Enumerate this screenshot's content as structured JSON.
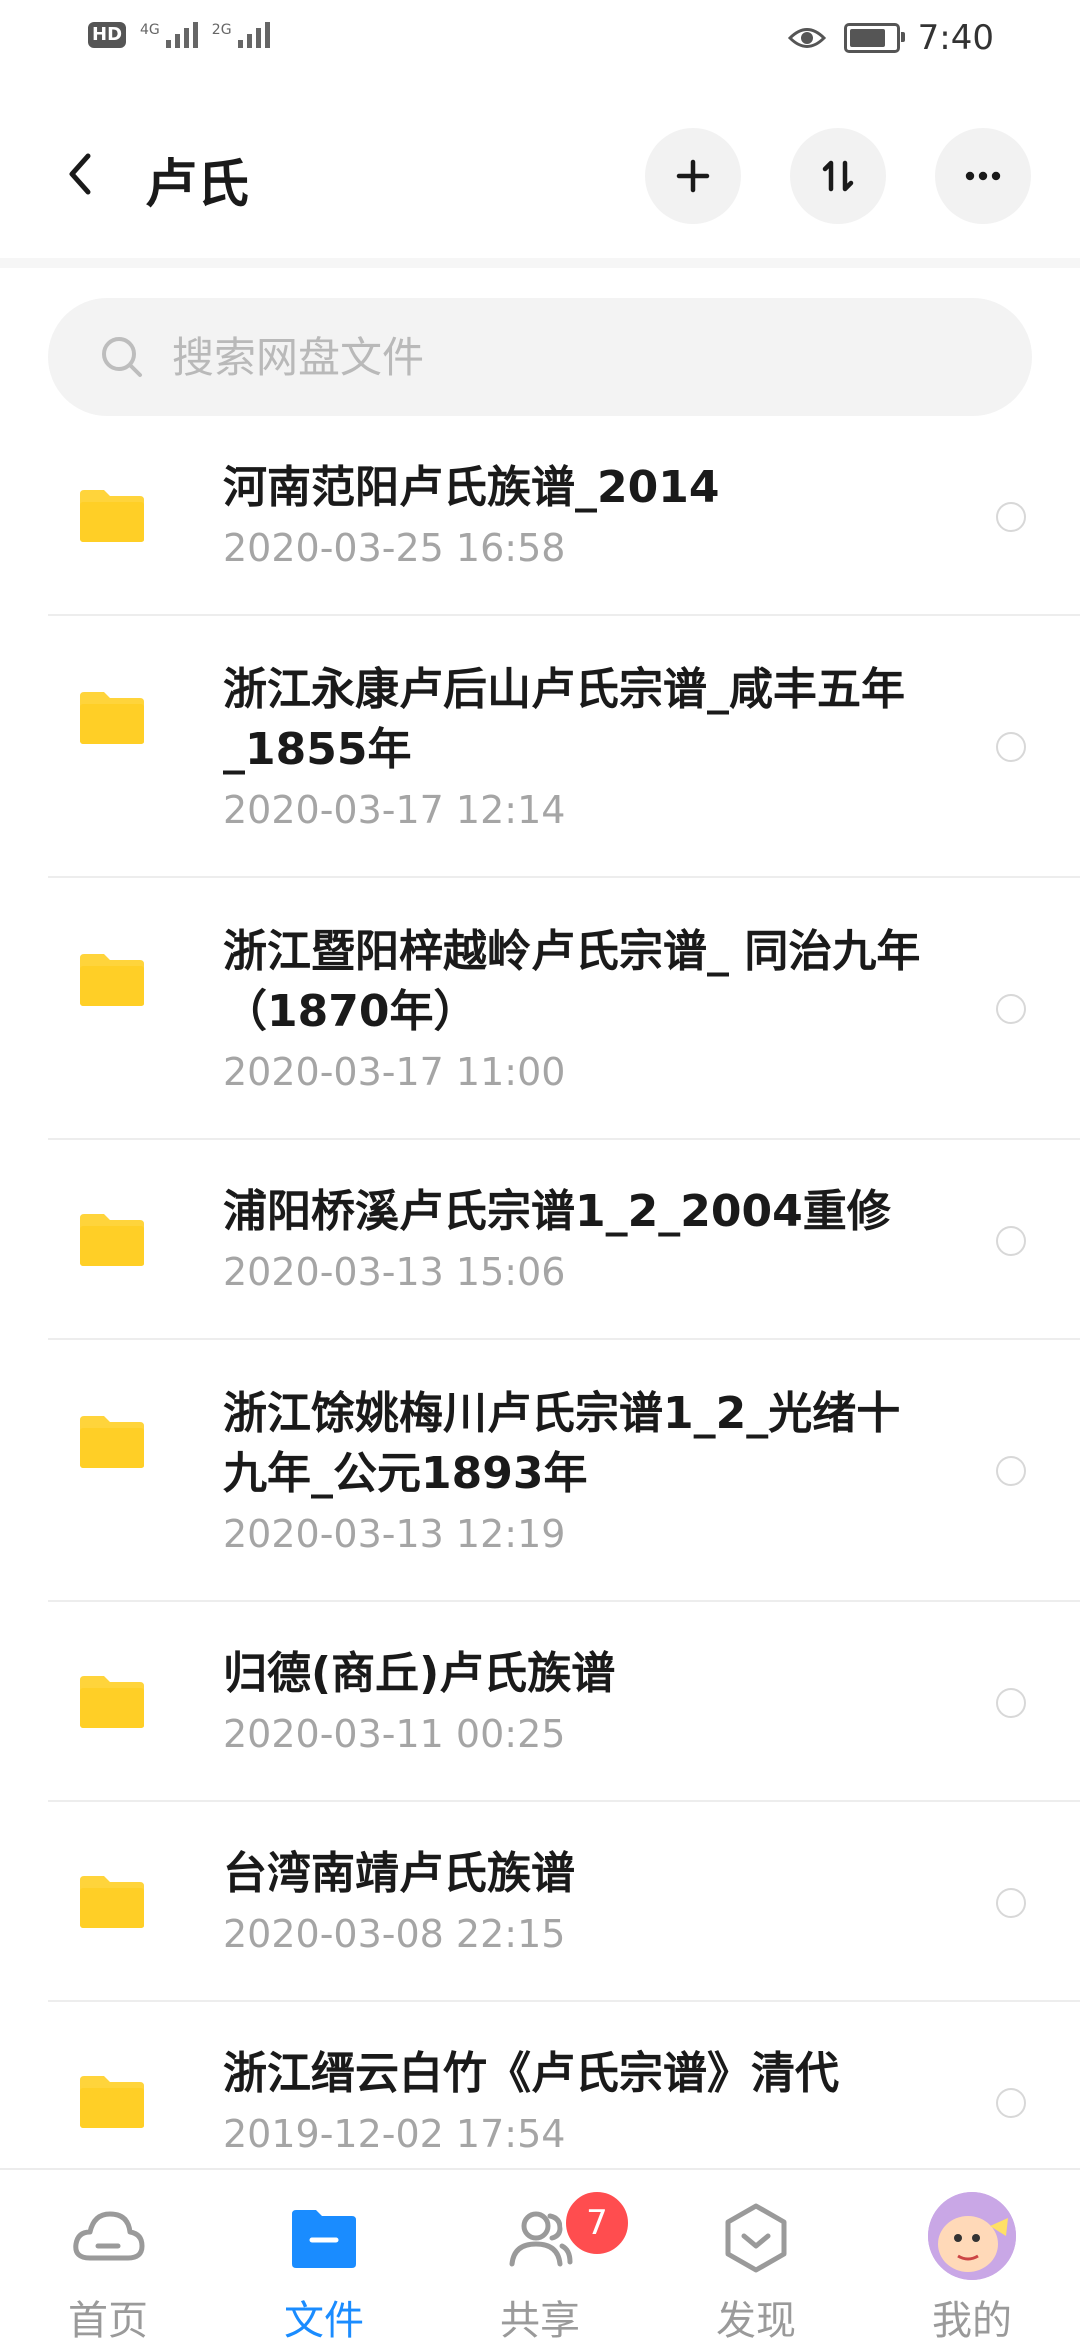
{
  "status_bar": {
    "hd": "HD",
    "sim1_net": "4G",
    "sim2_net": "2G",
    "time": "7:40",
    "battery_level": 0.7
  },
  "header": {
    "title": "卢氏",
    "add_icon": "plus-icon",
    "sort_icon": "sort-icon",
    "more_icon": "more-icon"
  },
  "search": {
    "placeholder": "搜索网盘文件"
  },
  "files": [
    {
      "name": "河南范阳卢氏族谱_2014",
      "date": "2020-03-25  16:58"
    },
    {
      "name": "浙江永康卢后山卢氏宗谱_咸丰五年_1855年",
      "date": "2020-03-17  12:14"
    },
    {
      "name": "浙江暨阳梓越岭卢氏宗谱_ 同治九年（1870年）",
      "date": "2020-03-17  11:00"
    },
    {
      "name": "浦阳桥溪卢氏宗谱1_2_2004重修",
      "date": "2020-03-13  15:06"
    },
    {
      "name": "浙江馀姚梅川卢氏宗谱1_2_光绪十九年_公元1893年",
      "date": "2020-03-13  12:19"
    },
    {
      "name": "归德(商丘)卢氏族谱",
      "date": "2020-03-11  00:25"
    },
    {
      "name": "台湾南靖卢氏族谱",
      "date": "2020-03-08  22:15"
    },
    {
      "name": "浙江缙云白竹《卢氏宗谱》清代",
      "date": "2019-12-02  17:54"
    }
  ],
  "nav": {
    "items": [
      {
        "label": "首页",
        "icon": "cloud-icon"
      },
      {
        "label": "文件",
        "icon": "folder-icon"
      },
      {
        "label": "共享",
        "icon": "people-icon",
        "badge": "7"
      },
      {
        "label": "发现",
        "icon": "discover-icon"
      },
      {
        "label": "我的",
        "icon": "avatar"
      }
    ],
    "active_color": "#1a8cff",
    "inactive_color": "#9a9a9a"
  },
  "colors": {
    "folder": "#ffd43b",
    "badge": "#ff4d4f"
  }
}
